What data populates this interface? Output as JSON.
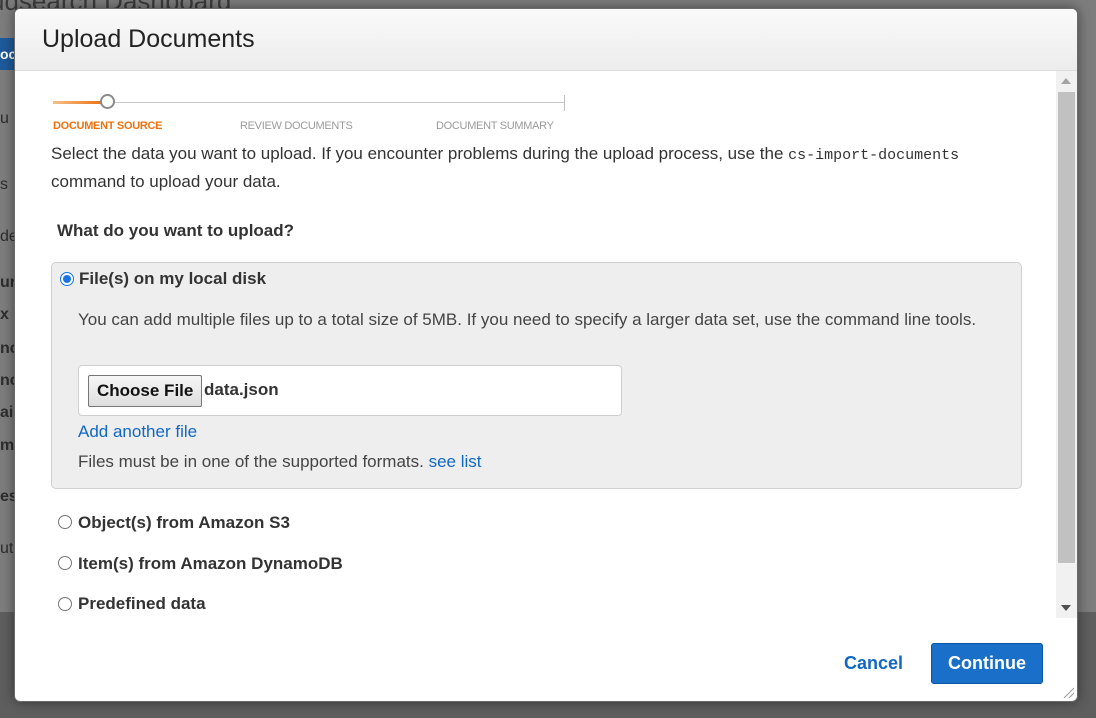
{
  "background": {
    "title": "udsearch Dashboard",
    "tab_fragment": "oc",
    "fragments": [
      "u",
      "s",
      "de",
      "ur",
      "x l",
      "nc",
      "nc",
      "ai",
      "me",
      "es",
      "ut"
    ]
  },
  "modal": {
    "title": "Upload Documents",
    "steps": [
      {
        "label": "DOCUMENT SOURCE",
        "active": true
      },
      {
        "label": "REVIEW DOCUMENTS",
        "active": false
      },
      {
        "label": "DOCUMENT SUMMARY",
        "active": false
      }
    ],
    "intro": {
      "before": "Select the data you want to upload. If you encounter problems during the upload process, use the ",
      "command": "cs-import-documents",
      "after": " command to upload your data."
    },
    "question": "What do you want to upload?",
    "options": [
      {
        "label": "File(s) on my local disk",
        "selected": true
      },
      {
        "label": "Object(s) from Amazon S3",
        "selected": false
      },
      {
        "label": "Item(s) from Amazon DynamoDB",
        "selected": false
      },
      {
        "label": "Predefined data",
        "selected": false
      }
    ],
    "local_disk": {
      "description": "You can add multiple files up to a total size of 5MB. If you need to specify a larger data set, use the command line tools.",
      "choose_file_label": "Choose File",
      "file_name": "data.json",
      "add_another_label": "Add another file",
      "formats_text": "Files must be in one of the supported formats. ",
      "see_list_label": "see list"
    },
    "footer": {
      "cancel_label": "Cancel",
      "continue_label": "Continue"
    }
  },
  "colors": {
    "accent": "#ec7211",
    "link": "#1167c4",
    "primary_button": "#1a6fc9"
  }
}
